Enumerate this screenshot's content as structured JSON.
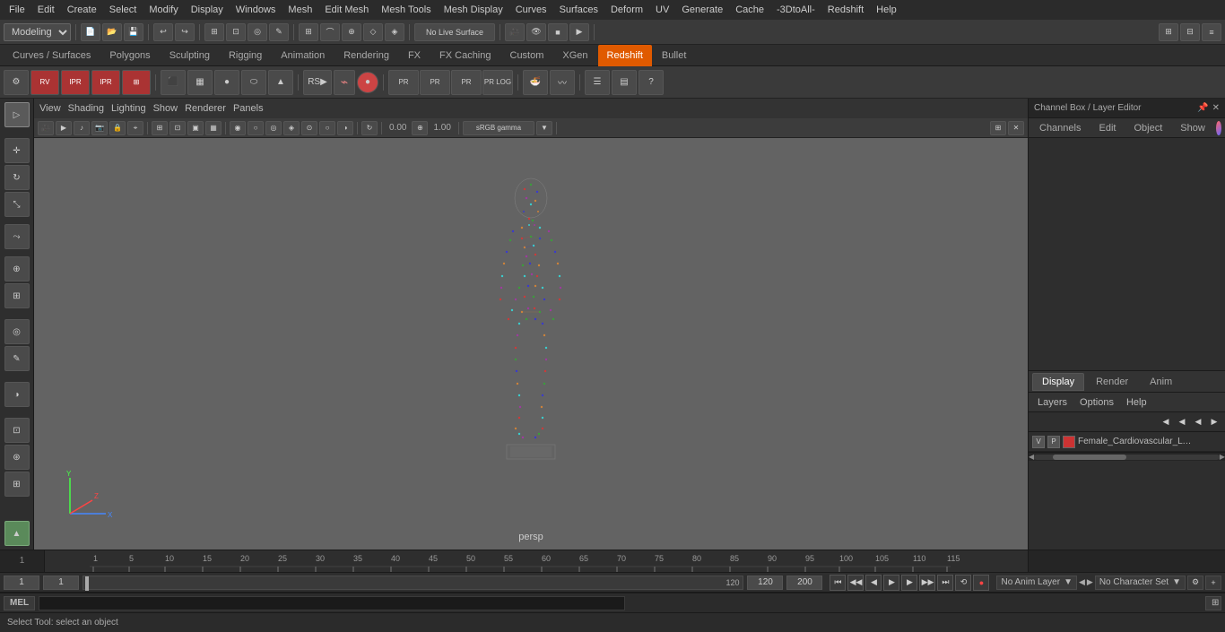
{
  "menubar": {
    "items": [
      "File",
      "Edit",
      "Create",
      "Select",
      "Modify",
      "Display",
      "Windows",
      "Mesh",
      "Edit Mesh",
      "Mesh Tools",
      "Mesh Display",
      "Curves",
      "Surfaces",
      "Deform",
      "UV",
      "Generate",
      "Cache",
      "-3DtoAll-",
      "Redshift",
      "Help"
    ]
  },
  "toolbar": {
    "workspace": "Modeling",
    "undo": "↩",
    "redo": "↪"
  },
  "tabs": {
    "items": [
      "Curves / Surfaces",
      "Polygons",
      "Sculpting",
      "Rigging",
      "Animation",
      "Rendering",
      "FX",
      "FX Caching",
      "Custom",
      "XGen",
      "Redshift",
      "Bullet"
    ],
    "active": "Redshift"
  },
  "viewport": {
    "menus": [
      "View",
      "Shading",
      "Lighting",
      "Show",
      "Renderer",
      "Panels"
    ],
    "label": "persp",
    "color_space": "sRGB gamma",
    "coord_x": "0.00",
    "coord_y": "1.00"
  },
  "channel_box": {
    "title": "Channel Box / Layer Editor",
    "tabs": [
      "Channels",
      "Edit",
      "Object",
      "Show"
    ],
    "active_tab": "Display"
  },
  "layer_editor": {
    "tabs": [
      "Display",
      "Render",
      "Anim"
    ],
    "active_tab": "Display",
    "menus": [
      "Layers",
      "Options",
      "Help"
    ],
    "layers": [
      {
        "v": "V",
        "p": "P",
        "color": "#cc3333",
        "name": "Female_Cardiovascular_Lymp"
      }
    ]
  },
  "timeline": {
    "start": 1,
    "end": 120,
    "markers": [
      1,
      5,
      10,
      15,
      20,
      25,
      30,
      35,
      40,
      45,
      50,
      55,
      60,
      65,
      70,
      75,
      80,
      85,
      90,
      95,
      100,
      105,
      110,
      115
    ]
  },
  "playback": {
    "current_frame": "1",
    "range_start": "1",
    "range_end": "120",
    "max_start": "120",
    "max_end": "200",
    "anim_layer": "No Anim Layer",
    "char_set": "No Character Set",
    "btns": [
      "⏮",
      "◀◀",
      "◀",
      "▶",
      "▶▶",
      "⏭",
      "⟲",
      "⟳",
      "●"
    ]
  },
  "statusbar": {
    "mel_label": "MEL",
    "status": "Select Tool: select an object"
  },
  "icons": {
    "select": "▷",
    "move": "✛",
    "rotate": "↻",
    "scale": "⤡",
    "lasso": "○",
    "snap": "⊕",
    "eye": "👁",
    "gear": "⚙",
    "close": "✕",
    "chevron_left": "◀",
    "chevron_right": "▶",
    "arrow_left": "◄",
    "arrow_right": "►"
  }
}
